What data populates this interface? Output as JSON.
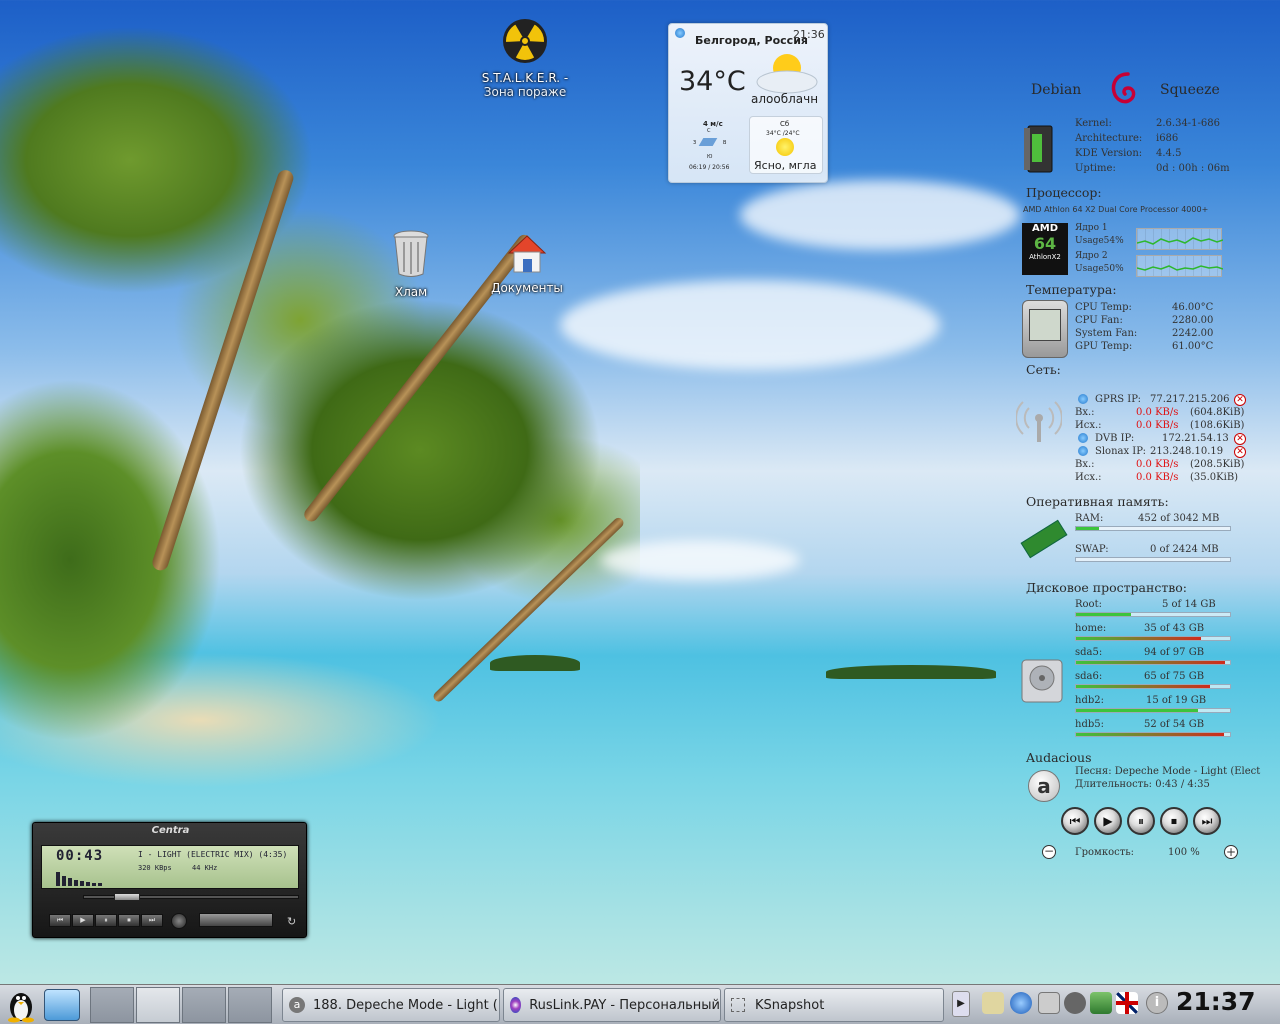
{
  "desktop": {
    "icons": [
      {
        "label": "S.T.A.L.K.E.R. -\nЗона поражения",
        "label1": "S.T.A.L.K.E.R. -",
        "label2": "Зона пораже",
        "icon": "radiation-icon"
      },
      {
        "label": "Хлам",
        "icon": "trash-icon"
      },
      {
        "label": "Документы",
        "icon": "home-folder-icon"
      }
    ]
  },
  "weather": {
    "city": "Белгород, Россия",
    "time": "21:36",
    "temp": "34°C",
    "condition": "алооблачн",
    "wind": "4 м/с",
    "dir_n": "С",
    "dir_w": "З",
    "dir_e": "В",
    "dir_s": "Ю",
    "sun": "06:19 / 20:56",
    "forecast_day": "Сб",
    "forecast_temp": "34°C /24°C",
    "forecast_text": "Ясно, мгла"
  },
  "conky": {
    "distro": "Debian",
    "release": "Squeeze",
    "system": [
      {
        "label": "Kernel:",
        "value": "2.6.34-1-686"
      },
      {
        "label": "Architecture:",
        "value": "i686"
      },
      {
        "label": "KDE Version:",
        "value": "4.4.5"
      },
      {
        "label": "Uptime:",
        "value": "0d : 00h : 06m"
      }
    ],
    "cpu_title": "Процессор:",
    "cpu_model": "AMD Athlon 64 X2 Dual Core Processor 4000+",
    "cpu_logo_top": "AMD",
    "cpu_logo_mid": "64",
    "cpu_logo_bot": "AthlonX2",
    "cores": [
      {
        "label": "Ядро 1",
        "usage": "Usage54%",
        "percent": 54
      },
      {
        "label": "Ядро 2",
        "usage": "Usage50%",
        "percent": 50
      }
    ],
    "temp_title": "Температура:",
    "temps": [
      {
        "label": "CPU Temp:",
        "value": "46.00°C"
      },
      {
        "label": "CPU Fan:",
        "value": "2280.00"
      },
      {
        "label": "System Fan:",
        "value": "2242.00"
      },
      {
        "label": "GPU Temp:",
        "value": "61.00°C"
      }
    ],
    "net_title": "Сеть:",
    "net": [
      {
        "name": "GPRS IP:",
        "ip": "77.217.215.206",
        "down_label": "Вх.:",
        "down": "0.0 KB/s",
        "down_total": "(604.8KiB)",
        "up_label": "Исх.:",
        "up": "0.0 KB/s",
        "up_total": "(108.6KiB)"
      },
      {
        "name": "DVB IP:",
        "ip": "172.21.54.13"
      },
      {
        "name": "Slonax IP:",
        "ip": "213.248.10.19",
        "down_label": "Вх.:",
        "down": "0.0 KB/s",
        "down_total": "(208.5KiB)",
        "up_label": "Исх.:",
        "up": "0.0 KB/s",
        "up_total": "(35.0KiB)"
      }
    ],
    "mem_title": "Оперативная память:",
    "mem": [
      {
        "label": "RAM:",
        "value": "452 of 3042 MB",
        "percent": 15
      },
      {
        "label": "SWAP:",
        "value": "0 of 2424 MB",
        "percent": 0
      }
    ],
    "disk_title": "Дисковое пространство:",
    "disks": [
      {
        "label": "Root:",
        "value": "5 of 14 GB",
        "percent": 36
      },
      {
        "label": "home:",
        "value": "35 of 43 GB",
        "percent": 81
      },
      {
        "label": "sda5:",
        "value": "94 of 97 GB",
        "percent": 97
      },
      {
        "label": "sda6:",
        "value": "65 of 75 GB",
        "percent": 87
      },
      {
        "label": "hdb2:",
        "value": "15 of 19 GB",
        "percent": 79
      },
      {
        "label": "hdb5:",
        "value": "52 of 54 GB",
        "percent": 96
      }
    ],
    "audio_title": "Audacious",
    "song": "Песня: Depeche Mode - Light (Elect",
    "duration": "Длительность: 0:43 / 4:35",
    "volume_label": "Громкость:",
    "volume": "100 %"
  },
  "player": {
    "skin_title": "Centra",
    "time": "00:43",
    "track": "I - LIGHT (ELECTRIC MIX) (4:35)",
    "bitrate": "320 KBps",
    "rate": "44 KHz",
    "progress": 0.16
  },
  "taskbar": {
    "tasks": [
      {
        "label": "188. Depeche Mode - Light (",
        "icon": "audacious-icon"
      },
      {
        "label": "RusLink.PAY - Персональный",
        "icon": "browser-icon"
      },
      {
        "label": "KSnapshot",
        "icon": "ksnapshot-icon"
      }
    ],
    "clock": "21:37"
  },
  "colors": {
    "bar_green": "#3cc43c",
    "bar_red": "#d02a1c",
    "net_red": "#e01010",
    "panel": "#b9bfc7"
  }
}
